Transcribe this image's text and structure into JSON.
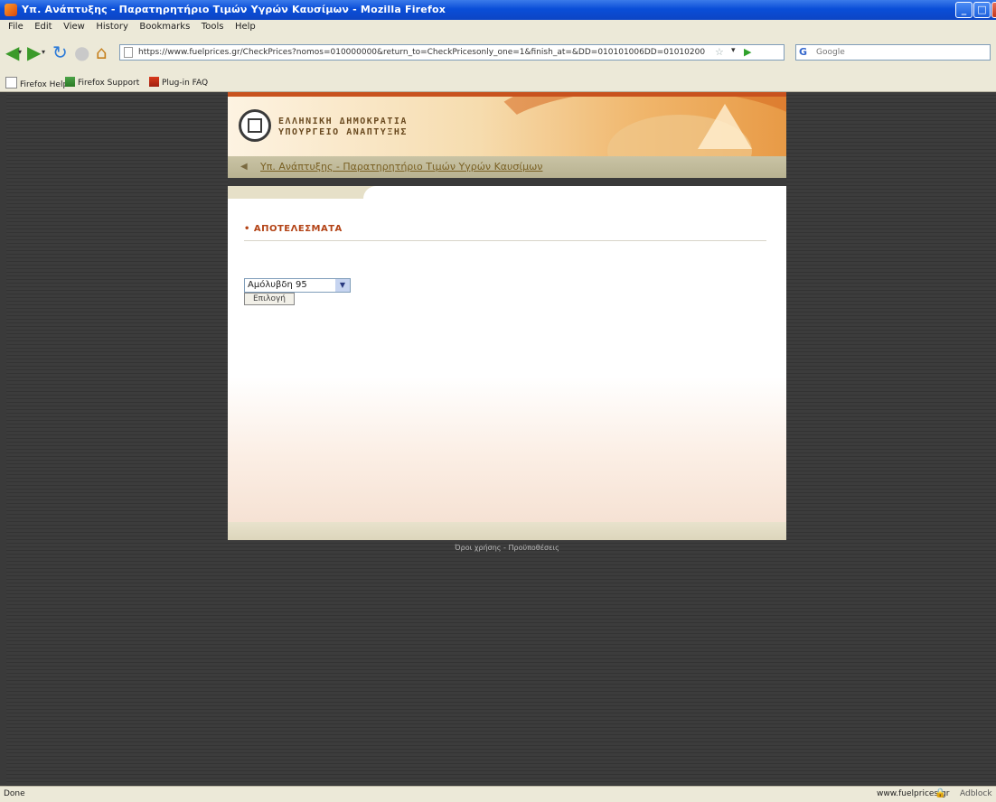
{
  "window": {
    "title": "Υπ. Ανάπτυξης - Παρατηρητήριο Τιμών Υγρών Καυσίμων - Mozilla Firefox",
    "controls": {
      "minimize": "_",
      "maximize": "□",
      "close": "×"
    }
  },
  "menubar": {
    "items": [
      "File",
      "Edit",
      "View",
      "History",
      "Bookmarks",
      "Tools",
      "Help"
    ]
  },
  "navbar": {
    "url": "https://www.fuelprices.gr/CheckPrices?nomos=010000000&return_to=CheckPricesonly_one=1&finish_at=&DD=010101006DD=01010200",
    "search_placeholder": "Google",
    "icons": [
      "back-icon",
      "forward-icon",
      "reload-icon",
      "stop-icon",
      "home-icon"
    ]
  },
  "bookmarks": {
    "items": [
      "Firefox Help",
      "Firefox Support",
      "Plug-in FAQ"
    ]
  },
  "site": {
    "logo_line1": "ΕΛΛΗΝΙΚΗ ΔΗΜΟΚΡΑΤΙΑ",
    "logo_line2": "ΥΠΟΥΡΓΕΙΟ ΑΝΑΠΤΥΞΗΣ",
    "nav_link": "Υπ. Ανάπτυξης - Παρατηρητήριο Τιμών Υγρών Καυσίμων",
    "results_heading": "• ΑΠΟΤΕΛΕΣΜΑΤΑ",
    "fuel_select": {
      "selected": "Αμόλυβδη 95",
      "options": [
        "Αμόλυβδη 95"
      ]
    },
    "submit_label": "Επιλογή",
    "footer_link": "Όροι χρήσης - Προϋποθέσεις"
  },
  "statusbar": {
    "left": "Done",
    "domain": "www.fuelprices.gr",
    "addon": "Adblock"
  },
  "colors": {
    "titlebar": "#0a4ed8",
    "chrome": "#ece9d8",
    "page_background": "#3a3a3a",
    "heading_accent": "#b34316"
  }
}
